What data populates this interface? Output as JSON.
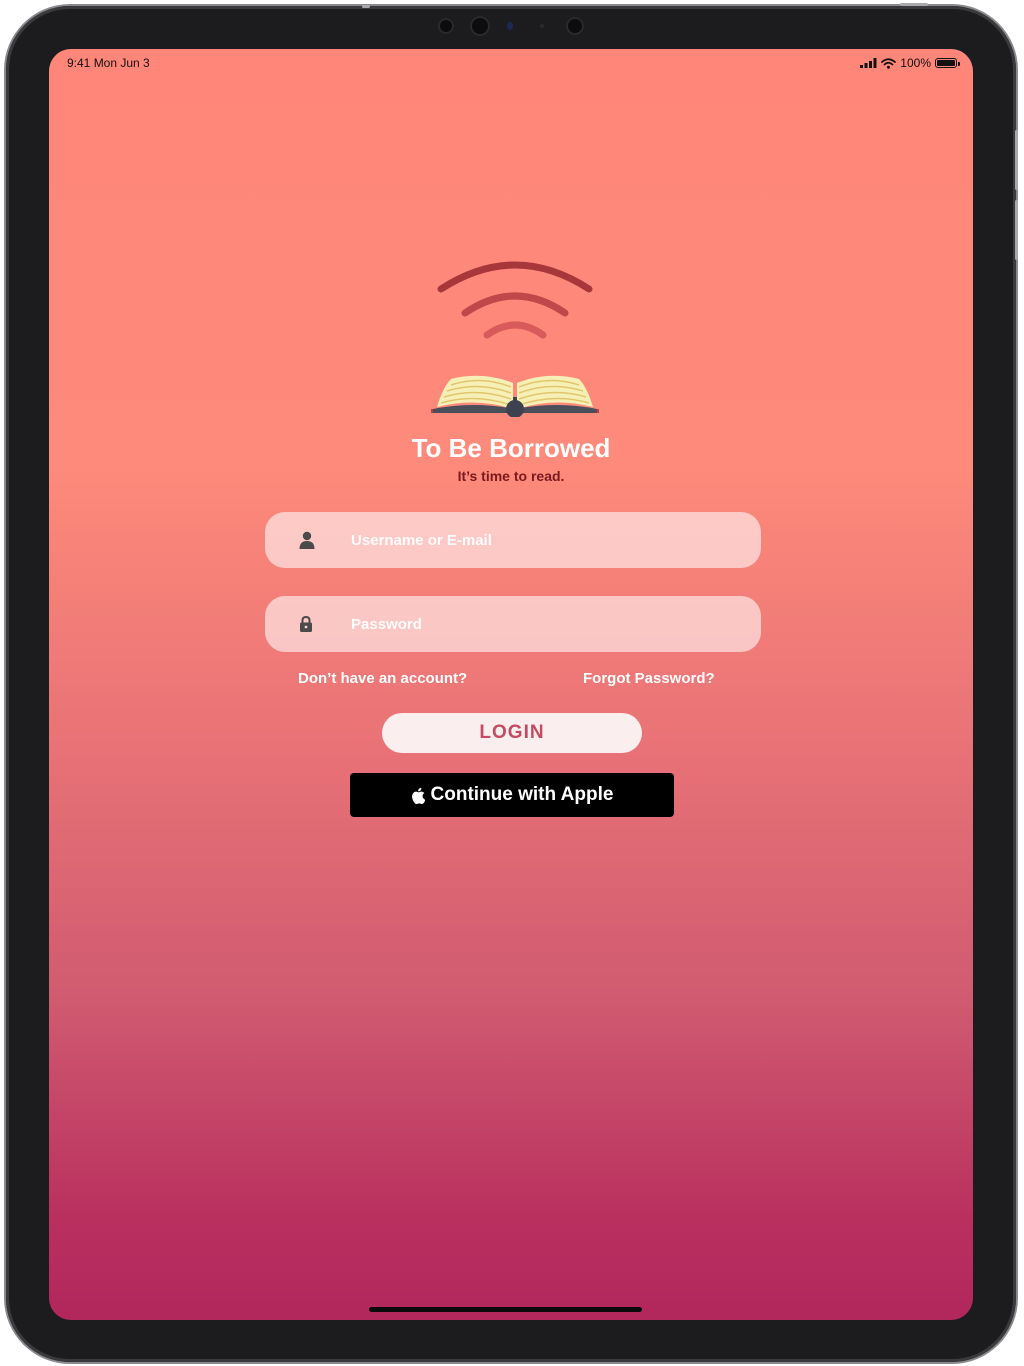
{
  "status_bar": {
    "time_date": "9:41  Mon Jun 3",
    "battery": "100%",
    "icons": [
      "signal-icon",
      "wifi-icon",
      "battery-icon"
    ]
  },
  "app": {
    "title": "To Be Borrowed",
    "tagline": "It’s time to read."
  },
  "form": {
    "username_placeholder": "Username or E-mail",
    "password_placeholder": "Password",
    "username_icon": "user-icon",
    "password_icon": "lock-icon"
  },
  "links": {
    "signup": "Don’t have an account?",
    "forgot": "Forgot Password?"
  },
  "buttons": {
    "login": "LOGIN",
    "apple": "Continue with Apple",
    "apple_icon": "apple-icon"
  },
  "colors": {
    "background_top": "#ff8679",
    "background_bottom": "#b2275c",
    "login_text": "#c44b63",
    "tagline": "#7a1a1f"
  }
}
